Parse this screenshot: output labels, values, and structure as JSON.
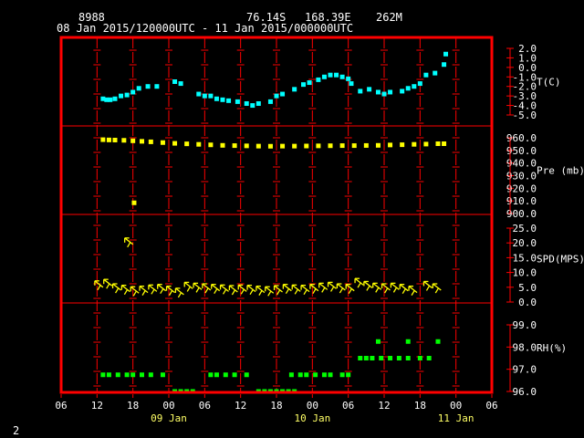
{
  "header": {
    "station_id": "8988",
    "lat": "76.14S",
    "lon": "168.39E",
    "elev": "262M",
    "period": "08 Jan 2015/120000UTC - 11 Jan 2015/000000UTC"
  },
  "page_number": "2",
  "colors": {
    "frame": "#ff0000",
    "grid": "#ff0000",
    "text": "#ffffff",
    "temperature": "#00ffff",
    "pressure": "#ffff00",
    "wind": "#ffff00",
    "rh": "#00ff00"
  },
  "chart_data": {
    "type": "scatter",
    "x_axis": {
      "unit": "hours since 08 Jan 2015 06UTC",
      "range": [
        0,
        72
      ],
      "tick_labels": [
        "06",
        "12",
        "18",
        "00",
        "06",
        "12",
        "18",
        "00",
        "06",
        "12",
        "18",
        "00",
        "06"
      ],
      "date_labels": [
        {
          "text": "09 Jan",
          "at": 18
        },
        {
          "text": "10 Jan",
          "at": 42
        },
        {
          "text": "11 Jan",
          "at": 66
        }
      ]
    },
    "panels": [
      {
        "name": "T(C)",
        "type": "scatter",
        "color": "#00ffff",
        "ylim": [
          -5,
          2
        ],
        "tick_labels": [
          "2.0",
          "1.0",
          "0.0",
          "-1.0",
          "-2.0",
          "-3.0",
          "-4.0",
          "-5.0"
        ],
        "points": [
          [
            7,
            -3.3
          ],
          [
            7.6,
            -3.4
          ],
          [
            8.2,
            -3.4
          ],
          [
            9,
            -3.3
          ],
          [
            10,
            -3.0
          ],
          [
            11,
            -2.9
          ],
          [
            12,
            -2.6
          ],
          [
            13,
            -2.2
          ],
          [
            14.5,
            -2.0
          ],
          [
            16,
            -2.0
          ],
          [
            19,
            -1.5
          ],
          [
            20,
            -1.7
          ],
          [
            23,
            -2.8
          ],
          [
            24,
            -3.0
          ],
          [
            25,
            -3.0
          ],
          [
            26,
            -3.3
          ],
          [
            27,
            -3.4
          ],
          [
            28,
            -3.5
          ],
          [
            29.5,
            -3.6
          ],
          [
            31,
            -3.8
          ],
          [
            32,
            -4.0
          ],
          [
            33,
            -3.8
          ],
          [
            35,
            -3.6
          ],
          [
            36,
            -3.0
          ],
          [
            37,
            -2.8
          ],
          [
            39,
            -2.3
          ],
          [
            40.5,
            -1.8
          ],
          [
            41.5,
            -1.6
          ],
          [
            43,
            -1.3
          ],
          [
            44,
            -1.0
          ],
          [
            45,
            -0.8
          ],
          [
            46,
            -0.8
          ],
          [
            47,
            -1.0
          ],
          [
            48,
            -1.2
          ],
          [
            48.5,
            -1.7
          ],
          [
            50,
            -2.5
          ],
          [
            51.5,
            -2.3
          ],
          [
            53,
            -2.6
          ],
          [
            54,
            -2.8
          ],
          [
            55,
            -2.6
          ],
          [
            57,
            -2.5
          ],
          [
            58,
            -2.2
          ],
          [
            59,
            -2.0
          ],
          [
            60,
            -1.7
          ],
          [
            61,
            -0.8
          ],
          [
            62.5,
            -0.6
          ],
          [
            64,
            0.3
          ],
          [
            64.3,
            1.4
          ]
        ]
      },
      {
        "name": "Pre (mb)",
        "type": "scatter",
        "color": "#ffff00",
        "ylim": [
          900,
          960
        ],
        "tick_labels": [
          "960.0",
          "950.0",
          "940.0",
          "930.0",
          "920.0",
          "910.0",
          "900.0"
        ],
        "points": [
          [
            7,
            958.5
          ],
          [
            8,
            958.3
          ],
          [
            9,
            958.2
          ],
          [
            10.5,
            958.0
          ],
          [
            12,
            957.6
          ],
          [
            13.5,
            957.2
          ],
          [
            15,
            956.8
          ],
          [
            17,
            956.2
          ],
          [
            19,
            955.6
          ],
          [
            21,
            955.2
          ],
          [
            23,
            954.8
          ],
          [
            25,
            954.4
          ],
          [
            27,
            954.0
          ],
          [
            29,
            953.8
          ],
          [
            31,
            953.6
          ],
          [
            33,
            953.4
          ],
          [
            35,
            953.3
          ],
          [
            37,
            953.4
          ],
          [
            39,
            953.4
          ],
          [
            41,
            953.5
          ],
          [
            43,
            953.6
          ],
          [
            45,
            953.7
          ],
          [
            47,
            953.8
          ],
          [
            49,
            953.8
          ],
          [
            51,
            953.9
          ],
          [
            53,
            954.0
          ],
          [
            55,
            954.3
          ],
          [
            57,
            954.5
          ],
          [
            59,
            954.8
          ],
          [
            61,
            955.0
          ],
          [
            63,
            955.3
          ],
          [
            64,
            955.3
          ],
          [
            12.2,
            908.5
          ]
        ]
      },
      {
        "name": "SPD(MPS)",
        "type": "wind-barbs",
        "color": "#ffff00",
        "ylim": [
          0,
          25
        ],
        "tick_labels": [
          "25.0",
          "20.0",
          "15.0",
          "10.0",
          "5.0",
          "0.0"
        ],
        "barbs": [
          [
            7,
            5.0
          ],
          [
            8.5,
            5.5
          ],
          [
            10,
            4.0
          ],
          [
            11.5,
            3.5
          ],
          [
            13,
            3.0
          ],
          [
            14.5,
            3.2
          ],
          [
            16,
            3.6
          ],
          [
            17.5,
            3.8
          ],
          [
            19,
            3.2
          ],
          [
            20.5,
            2.5
          ],
          [
            22,
            4.5
          ],
          [
            23.5,
            4.2
          ],
          [
            25,
            4.0
          ],
          [
            26.5,
            3.8
          ],
          [
            28,
            3.6
          ],
          [
            29.5,
            3.4
          ],
          [
            31,
            3.6
          ],
          [
            32.5,
            3.5
          ],
          [
            34,
            3.2
          ],
          [
            35.5,
            3.0
          ],
          [
            37,
            3.4
          ],
          [
            38.5,
            3.8
          ],
          [
            40,
            3.6
          ],
          [
            41.5,
            3.5
          ],
          [
            43,
            3.8
          ],
          [
            44.5,
            4.2
          ],
          [
            46,
            4.5
          ],
          [
            47.5,
            4.0
          ],
          [
            49,
            3.8
          ],
          [
            50.5,
            5.8
          ],
          [
            52,
            4.8
          ],
          [
            53.5,
            4.2
          ],
          [
            55,
            4.0
          ],
          [
            56.5,
            4.2
          ],
          [
            58,
            3.8
          ],
          [
            59.5,
            3.2
          ],
          [
            62,
            4.8
          ],
          [
            63.5,
            4.0
          ],
          [
            12,
            19.5
          ]
        ]
      },
      {
        "name": "RH(%)",
        "type": "scatter",
        "color": "#00ff00",
        "ylim": [
          96,
          100
        ],
        "tick_labels": [
          "99.0",
          "98.0",
          "97.0",
          "96.0"
        ],
        "points": [
          [
            7,
            97
          ],
          [
            8,
            97
          ],
          [
            9.5,
            97
          ],
          [
            11,
            97
          ],
          [
            12,
            97
          ],
          [
            13.5,
            97
          ],
          [
            15,
            97
          ],
          [
            17,
            97
          ],
          [
            25,
            97
          ],
          [
            26,
            97
          ],
          [
            27.5,
            97
          ],
          [
            29,
            97
          ],
          [
            31,
            97
          ],
          [
            38.5,
            97
          ],
          [
            40,
            97
          ],
          [
            41,
            97
          ],
          [
            42.5,
            97
          ],
          [
            44,
            97
          ],
          [
            45,
            97
          ],
          [
            47,
            97
          ],
          [
            48,
            97
          ],
          [
            50,
            98
          ],
          [
            51,
            98
          ],
          [
            52,
            98
          ],
          [
            53.5,
            98
          ],
          [
            55,
            98
          ],
          [
            56.5,
            98
          ],
          [
            58,
            98
          ],
          [
            60,
            98
          ],
          [
            61.5,
            98
          ],
          [
            53,
            99
          ],
          [
            58,
            99
          ],
          [
            63,
            99
          ],
          [
            19,
            96
          ],
          [
            20,
            96
          ],
          [
            21,
            96
          ],
          [
            22,
            96
          ],
          [
            33,
            96
          ],
          [
            34,
            96
          ],
          [
            35,
            96
          ],
          [
            36,
            96
          ],
          [
            37,
            96
          ],
          [
            38,
            96
          ],
          [
            39,
            96
          ]
        ]
      }
    ]
  }
}
